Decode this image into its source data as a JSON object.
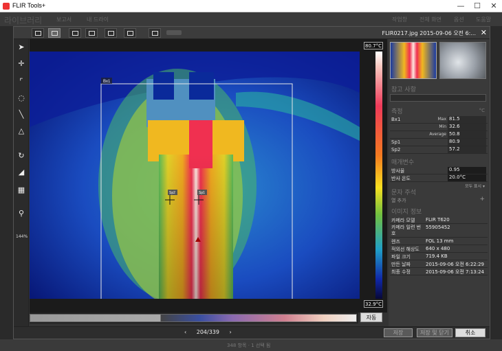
{
  "window": {
    "title": "FLIR Tools+",
    "minimize_glyph": "—",
    "maximize_glyph": "☐",
    "close_glyph": "✕"
  },
  "library_bar": {
    "title": "라이브러리",
    "items": [
      "보고서",
      "내 드라이",
      "작업창",
      "전체 화면",
      "옵션",
      "도움말"
    ]
  },
  "dialog": {
    "file_title": "FLIR0217.jpg    2015-09-06 오전 6:...",
    "close_glyph": "✕",
    "range_max": "80.7°C",
    "range_min": "32.9°C",
    "auto_button": "자동",
    "zoom_level": "144%",
    "markers": {
      "box_label": "Bx1",
      "sp1_label": "Sp1",
      "sp2_label": "Sp2"
    },
    "colors": {
      "dialog_bg": "#333333",
      "accent_red": "#ef3a5a",
      "iron_yellow": "#f8e020",
      "cold_blue": "#0a1a8a"
    }
  },
  "tools": [
    "arrow-select-icon",
    "spot-icon",
    "box-icon",
    "circle-icon",
    "line-icon",
    "delta-icon",
    "rotate-icon",
    "palette-icon",
    "fusion-icon",
    "zoom-icon"
  ],
  "panel": {
    "notes_header": "참고 사항",
    "measure_header": "측정",
    "measure_unit": "°C",
    "measurements": [
      {
        "name": "Bx1",
        "sub": "Max",
        "value": "81.5"
      },
      {
        "name": "",
        "sub": "Min",
        "value": "32.6"
      },
      {
        "name": "",
        "sub": "Average",
        "value": "50.8"
      },
      {
        "name": "Sp1",
        "sub": "",
        "value": "80.9"
      },
      {
        "name": "Sp2",
        "sub": "",
        "value": "57.2"
      }
    ],
    "params_header": "매개변수",
    "params": [
      {
        "name": "방사율",
        "value": "0.95"
      },
      {
        "name": "반사 온도",
        "value": "20.0°C"
      }
    ],
    "show_all": "모두 표시 ▾",
    "text_annotation_header": "문자 주석",
    "add_row": "열 추가",
    "add_glyph": "+",
    "image_info_header": "이미지 정보",
    "image_info": [
      {
        "name": "카메라 모델",
        "value": "FLIR T620"
      },
      {
        "name": "카메라 일련 번호",
        "value": "55905452"
      },
      {
        "name": "렌즈",
        "value": "FOL 13 mm"
      },
      {
        "name": "적외선 해상도",
        "value": "640 x 480"
      },
      {
        "name": "파일 크기",
        "value": "719.4 KB"
      },
      {
        "name": "만든 날짜",
        "value": "2015-09-06 오전 6:22:29"
      },
      {
        "name": "최종 수정",
        "value": "2015-09-06 오전 7:13:24"
      }
    ]
  },
  "bottom": {
    "prev_glyph": "‹",
    "page": "204/339",
    "next_glyph": "›",
    "save": "저장",
    "save_close": "저장 및 닫기",
    "cancel": "취소"
  },
  "status": {
    "text": "348 항목 · 1 선택 됨"
  }
}
